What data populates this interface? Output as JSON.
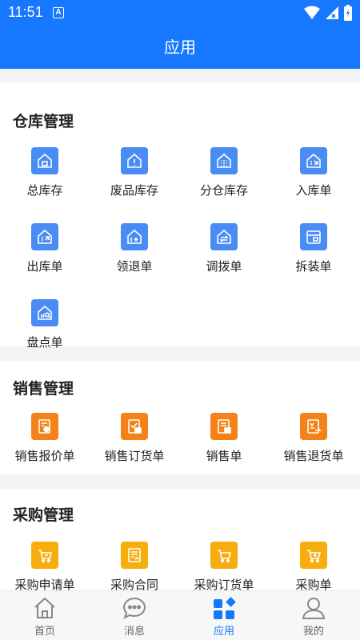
{
  "status_bar": {
    "time": "11:51",
    "notification_letter": "A"
  },
  "app_bar": {
    "title": "应用"
  },
  "colors": {
    "primary": "#1677ff",
    "warehouse_icon": "#4a8cf5",
    "sales_icon": "#f48218",
    "purchase_icon": "#f7ad0e"
  },
  "sections": {
    "warehouse": {
      "title": "仓库管理",
      "items": [
        {
          "label": "总库存",
          "icon": "total-inventory-icon"
        },
        {
          "label": "废品库存",
          "icon": "scrap-inventory-icon"
        },
        {
          "label": "分仓库存",
          "icon": "branch-inventory-icon"
        },
        {
          "label": "入库单",
          "icon": "stock-in-icon"
        },
        {
          "label": "出库单",
          "icon": "stock-out-icon"
        },
        {
          "label": "领退单",
          "icon": "requisition-return-icon"
        },
        {
          "label": "调拨单",
          "icon": "transfer-icon"
        },
        {
          "label": "拆装单",
          "icon": "assembly-icon"
        },
        {
          "label": "盘点单",
          "icon": "stocktake-icon"
        }
      ]
    },
    "sales": {
      "title": "销售管理",
      "items": [
        {
          "label": "销售报价单",
          "icon": "sales-quote-icon"
        },
        {
          "label": "销售订货单",
          "icon": "sales-order-icon"
        },
        {
          "label": "销售单",
          "icon": "sales-slip-icon"
        },
        {
          "label": "销售退货单",
          "icon": "sales-return-icon"
        }
      ]
    },
    "purchase": {
      "title": "采购管理",
      "items": [
        {
          "label": "采购申请单",
          "icon": "purchase-request-icon"
        },
        {
          "label": "采购合同",
          "icon": "purchase-contract-icon"
        },
        {
          "label": "采购订货单",
          "icon": "purchase-order-icon"
        },
        {
          "label": "采购单",
          "icon": "purchase-slip-icon"
        }
      ]
    }
  },
  "tabbar": {
    "items": [
      {
        "label": "首页",
        "icon": "home-icon",
        "active": false
      },
      {
        "label": "消息",
        "icon": "message-icon",
        "active": false
      },
      {
        "label": "应用",
        "icon": "apps-icon",
        "active": true
      },
      {
        "label": "我的",
        "icon": "profile-icon",
        "active": false
      }
    ]
  }
}
